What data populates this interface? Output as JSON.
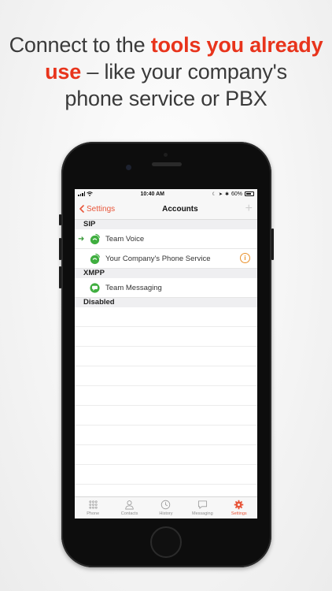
{
  "headline": {
    "line1_pre": "Connect to the ",
    "line1_hl": "tools you already",
    "line2_hl": "use",
    "line2_post": " – like your company's",
    "line3": "phone service or PBX"
  },
  "status": {
    "time": "10:40 AM",
    "battery": "60%"
  },
  "nav": {
    "back": "Settings",
    "title": "Accounts",
    "add": "+"
  },
  "sections": {
    "sip": "SIP",
    "xmpp": "XMPP",
    "disabled": "Disabled"
  },
  "accounts": {
    "team_voice": "Team Voice",
    "company_phone": "Your Company's Phone Service",
    "team_messaging": "Team Messaging"
  },
  "tabs": [
    {
      "label": "Phone",
      "icon": "keypad-icon"
    },
    {
      "label": "Contacts",
      "icon": "person-icon"
    },
    {
      "label": "History",
      "icon": "clock-icon"
    },
    {
      "label": "Messaging",
      "icon": "chat-icon"
    },
    {
      "label": "Settings",
      "icon": "gear-icon"
    }
  ],
  "colors": {
    "accent": "#e8563a",
    "headline_accent": "#e8341c",
    "online": "#3a9a3a",
    "warning": "#e9902a"
  }
}
